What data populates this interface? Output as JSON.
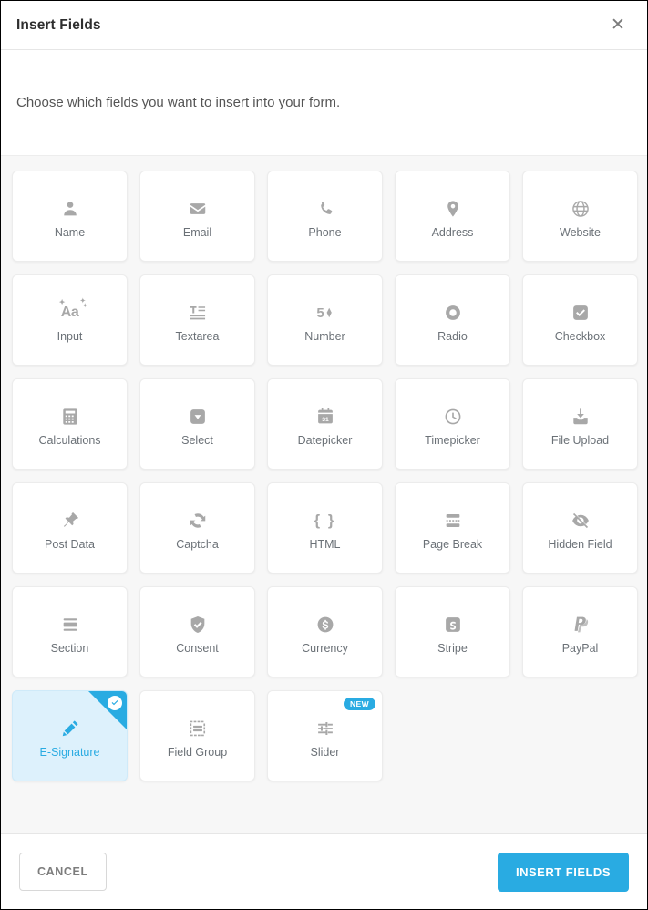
{
  "header": {
    "title": "Insert Fields",
    "close_label": "✕"
  },
  "intro": {
    "text": "Choose which fields you want to insert into your form."
  },
  "colors": {
    "accent": "#29abe2",
    "selected_background": "#ddf1fc",
    "panel_background": "#f7f7f7",
    "icon_gray": "#a8a8a8",
    "label_gray": "#6b7177"
  },
  "fields": [
    {
      "label": "Name",
      "icon": "person-icon",
      "selected": false,
      "badge": null
    },
    {
      "label": "Email",
      "icon": "envelope-icon",
      "selected": false,
      "badge": null
    },
    {
      "label": "Phone",
      "icon": "phone-icon",
      "selected": false,
      "badge": null
    },
    {
      "label": "Address",
      "icon": "map-pin-icon",
      "selected": false,
      "badge": null
    },
    {
      "label": "Website",
      "icon": "globe-icon",
      "selected": false,
      "badge": null
    },
    {
      "label": "Input",
      "icon": "text-input-icon",
      "selected": false,
      "badge": null
    },
    {
      "label": "Textarea",
      "icon": "textarea-icon",
      "selected": false,
      "badge": null
    },
    {
      "label": "Number",
      "icon": "number-stepper-icon",
      "selected": false,
      "badge": null
    },
    {
      "label": "Radio",
      "icon": "radio-icon",
      "selected": false,
      "badge": null
    },
    {
      "label": "Checkbox",
      "icon": "checkbox-icon",
      "selected": false,
      "badge": null
    },
    {
      "label": "Calculations",
      "icon": "calculator-icon",
      "selected": false,
      "badge": null
    },
    {
      "label": "Select",
      "icon": "dropdown-icon",
      "selected": false,
      "badge": null
    },
    {
      "label": "Datepicker",
      "icon": "calendar-icon",
      "selected": false,
      "badge": null
    },
    {
      "label": "Timepicker",
      "icon": "clock-icon",
      "selected": false,
      "badge": null
    },
    {
      "label": "File Upload",
      "icon": "upload-tray-icon",
      "selected": false,
      "badge": null
    },
    {
      "label": "Post Data",
      "icon": "pushpin-icon",
      "selected": false,
      "badge": null
    },
    {
      "label": "Captcha",
      "icon": "refresh-icon",
      "selected": false,
      "badge": null
    },
    {
      "label": "HTML",
      "icon": "curly-braces-icon",
      "selected": false,
      "badge": null
    },
    {
      "label": "Page Break",
      "icon": "page-break-icon",
      "selected": false,
      "badge": null
    },
    {
      "label": "Hidden Field",
      "icon": "eye-slash-icon",
      "selected": false,
      "badge": null
    },
    {
      "label": "Section",
      "icon": "section-icon",
      "selected": false,
      "badge": null
    },
    {
      "label": "Consent",
      "icon": "shield-check-icon",
      "selected": false,
      "badge": null
    },
    {
      "label": "Currency",
      "icon": "dollar-circle-icon",
      "selected": false,
      "badge": null
    },
    {
      "label": "Stripe",
      "icon": "stripe-icon",
      "selected": false,
      "badge": null
    },
    {
      "label": "PayPal",
      "icon": "paypal-icon",
      "selected": false,
      "badge": null
    },
    {
      "label": "E-Signature",
      "icon": "pencil-icon",
      "selected": true,
      "badge": null
    },
    {
      "label": "Field Group",
      "icon": "field-group-icon",
      "selected": false,
      "badge": null
    },
    {
      "label": "Slider",
      "icon": "sliders-icon",
      "selected": false,
      "badge": "NEW"
    }
  ],
  "calendar_day": "31",
  "number_value": "5",
  "html_glyph": "{ }",
  "stripe_glyph": "S",
  "footer": {
    "cancel_label": "CANCEL",
    "insert_label": "INSERT FIELDS"
  }
}
